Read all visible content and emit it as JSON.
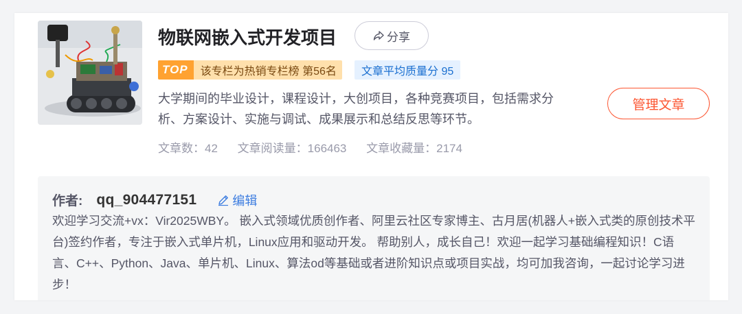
{
  "column": {
    "title": "物联网嵌入式开发项目",
    "share_label": "分享",
    "rank_tag": "TOP",
    "rank_text": "该专栏为热销专栏榜 第56名",
    "quality_score": "文章平均质量分 95",
    "description": "大学期间的毕业设计，课程设计，大创项目，各种竞赛项目，包括需求分析、方案设计、实施与调试、成果展示和总结反思等环节。",
    "manage_label": "管理文章",
    "stats": [
      {
        "label": "文章数：42"
      },
      {
        "label": "文章阅读量：166463"
      },
      {
        "label": "文章收藏量：2174"
      }
    ]
  },
  "author": {
    "label": "作者:",
    "name": "qq_904477151",
    "edit_label": "编辑",
    "bio": "欢迎学习交流+vx：Vir2025WBY。 嵌入式领域优质创作者、阿里云社区专家博主、古月居(机器人+嵌入式类的原创技术平台)签约作者，专注于嵌入式单片机，Linux应用和驱动开发。 帮助别人，成长自己！欢迎一起学习基础编程知识！C语言、C++、Python、Java、单片机、Linux、算法od等基础或者进阶知识点或项目实战，均可加我咨询，一起讨论学习进步！"
  },
  "colors": {
    "accent": "#fc5531",
    "rank_bg": "#ffe0ac",
    "rank_tag_bg": "#ffa231",
    "score_bg": "#e5f1ff",
    "score_text": "#1a6fd0",
    "link": "#3d7de0"
  },
  "icons": {
    "share": "share-arrow-icon",
    "edit": "pencil-icon"
  }
}
